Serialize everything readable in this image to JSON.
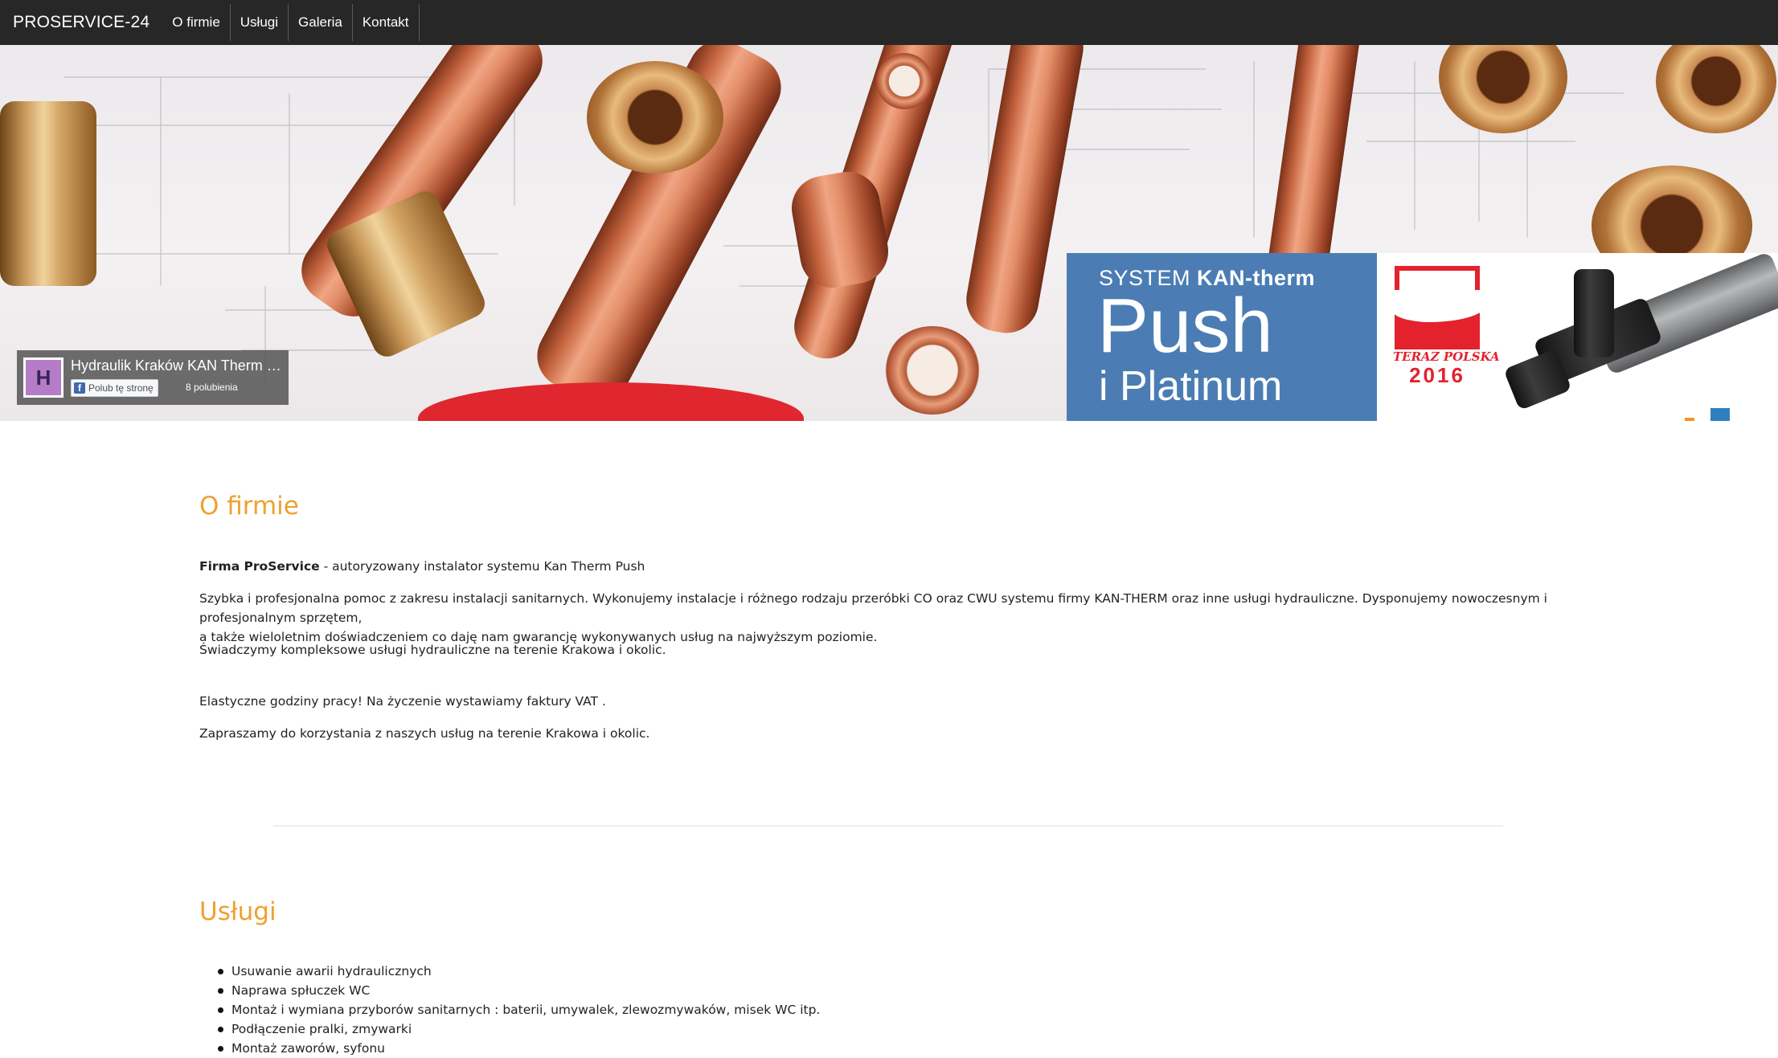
{
  "nav": {
    "brand": "PROSERVICE-24",
    "items": [
      {
        "label": "O firmie"
      },
      {
        "label": "Usługi"
      },
      {
        "label": "Galeria"
      },
      {
        "label": "Kontakt"
      }
    ]
  },
  "banner": {
    "kan_system": "SYSTEM",
    "kan_brand": "KAN-therm",
    "kan_push": "Push",
    "kan_platinum": "i Platinum",
    "teraz_text": "TERAZ POLSKA",
    "teraz_year": "2016"
  },
  "facebook": {
    "avatar_letter": "H",
    "page_name": "Hydraulik Kraków KAN Therm Push",
    "like_label": "Polub tę stronę",
    "likes_count": "8 polubienia"
  },
  "about": {
    "title": "O firmie",
    "intro_bold": "Firma ProService",
    "intro_rest": " - autoryzowany instalator systemu Kan Therm Push",
    "paragraph1_line1": "Szybka i profesjonalna pomoc z zakresu instalacji sanitarnych. Wykonujemy instalacje i różnego rodzaju przeróbki CO oraz CWU systemu firmy KAN-THERM oraz inne usługi hydrauliczne. Dysponujemy nowoczesnym i profesjonalnym sprzętem,",
    "paragraph1_line2": "a także wieloletnim doświadczeniem co daję nam gwarancję wykonywanych usług na najwyższym poziomie.",
    "paragraph2": "Świadczymy kompleksowe usługi hydrauliczne na terenie Krakowa i okolic.",
    "paragraph3": "Elastyczne godziny pracy! Na życzenie wystawiamy faktury VAT .",
    "paragraph4": "Zapraszamy do korzystania z naszych usług na terenie Krakowa i okolic."
  },
  "services": {
    "title": "Usługi",
    "items": [
      "Usuwanie awarii hydraulicznych",
      "Naprawa spłuczek WC",
      "Montaż i wymiana przyborów sanitarnych : baterii, umywalek, zlewozmywaków, misek WC itp.",
      "Podłączenie pralki, zmywarki",
      "Montaż zaworów, syfonu"
    ]
  },
  "colors": {
    "navbar_bg": "#272727",
    "section_title": "#f0a030",
    "kan_blue": "#4b7db4",
    "teraz_red": "#e3222d"
  }
}
